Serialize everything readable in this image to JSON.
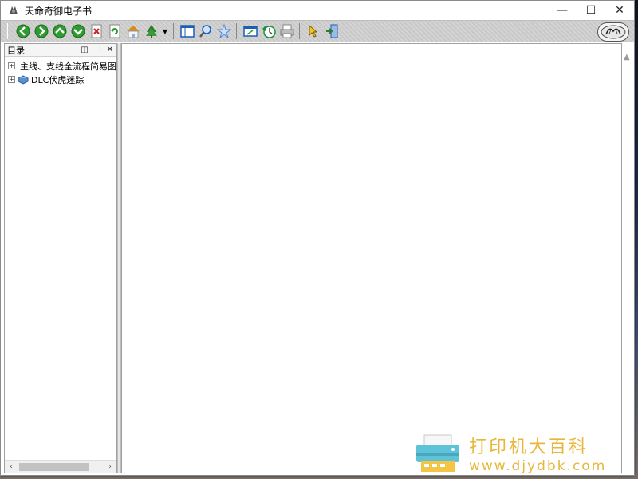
{
  "window": {
    "title": "天命奇御电子书",
    "controls": {
      "minimize": "—",
      "maximize": "☐",
      "close": "✕"
    }
  },
  "toolbar": {
    "buttons": [
      {
        "name": "back-button",
        "icon": "arrow-left-icon",
        "color": "#2e9b2e"
      },
      {
        "name": "forward-button",
        "icon": "arrow-right-icon",
        "color": "#2e9b2e"
      },
      {
        "name": "up-button",
        "icon": "arrow-up-icon",
        "color": "#2e9b2e"
      },
      {
        "name": "down-button",
        "icon": "arrow-down-icon",
        "color": "#2e9b2e"
      },
      {
        "name": "stop-button",
        "icon": "stop-icon",
        "color": "#d02020"
      },
      {
        "name": "refresh-button",
        "icon": "refresh-icon",
        "color": "#2e9b2e"
      },
      {
        "name": "home-button",
        "icon": "home-icon",
        "color": "#d88a1a"
      },
      {
        "name": "bookmark-button",
        "icon": "tree-icon",
        "color": "#2e7b2e"
      },
      {
        "name": "contents-button",
        "icon": "contents-icon",
        "color": "#1a5fb4"
      },
      {
        "name": "search-button",
        "icon": "search-icon",
        "color": "#1a5fb4"
      },
      {
        "name": "favorites-button",
        "icon": "star-icon",
        "color": "#4a86d8"
      },
      {
        "name": "fullscreen-button",
        "icon": "window-icon",
        "color": "#1a5fb4"
      },
      {
        "name": "history-button",
        "icon": "history-icon",
        "color": "#1a8f3a"
      },
      {
        "name": "print-button",
        "icon": "print-icon",
        "color": "#7a7a7a"
      },
      {
        "name": "pointer-button",
        "icon": "pointer-icon",
        "color": "#e0b020"
      },
      {
        "name": "exit-button",
        "icon": "exit-icon",
        "color": "#1a5fb4"
      }
    ]
  },
  "left_pane": {
    "title": "目录",
    "controls": {
      "dock": "◫",
      "pin": "⊣",
      "close": "✕"
    },
    "tree": [
      {
        "label": "主线、支线全流程简易图",
        "expander": "+"
      },
      {
        "label": "DLC伏虎迷踪",
        "expander": "+"
      }
    ],
    "scrollbar": {
      "left": "‹",
      "right": "›"
    }
  },
  "content": {
    "scroll_up": "▲"
  },
  "watermark": {
    "title": "打印机大百科",
    "url": "www.djydbk.com",
    "color": "#e8b63a"
  }
}
